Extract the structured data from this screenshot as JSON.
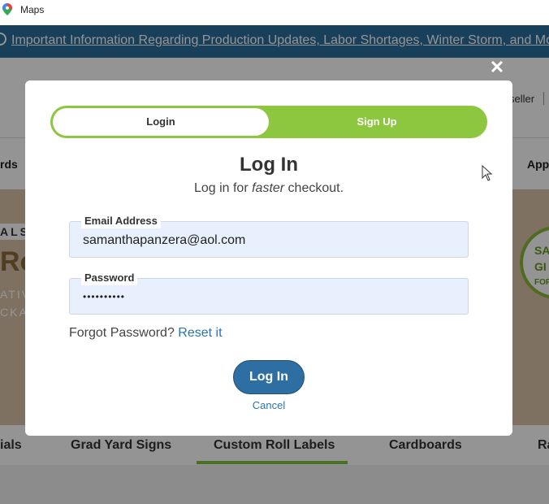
{
  "browser": {
    "title": "Maps"
  },
  "page": {
    "banner_text": "Important Information Regarding Production Updates, Labor Shortages, Winter Storm, and Mo",
    "header_reseller": "seller",
    "nav": {
      "left_cut": "rds",
      "right_cut": "Appa"
    },
    "hero": {
      "tag": "ALS",
      "headline": "Ro",
      "sub_lines": [
        "ATIV",
        "CKAC"
      ],
      "seal_lines": [
        "SA",
        "GI",
        "FOR 15T"
      ]
    },
    "category_tabs": [
      "ials",
      "Grad Yard Signs",
      "Custom Roll Labels",
      "Cardboards",
      "Ra"
    ]
  },
  "modal": {
    "close_symbol": "✕",
    "toggle": {
      "login_label": "Login",
      "signup_label": "Sign Up",
      "active": "login"
    },
    "title": "Log In",
    "subtitle_prefix": "Log in for ",
    "subtitle_emphasis": "faster",
    "subtitle_suffix": " checkout.",
    "email": {
      "label": "Email Address",
      "value": "samanthapanzera@aol.com"
    },
    "password": {
      "label": "Password",
      "masked_value": "••••••••••"
    },
    "forgot_text": "Forgot Password?",
    "reset_link": "Reset it",
    "submit_label": "Log In",
    "cancel_label": "Cancel"
  },
  "colors": {
    "accent_green": "#8dc63f",
    "primary_blue": "#2d6ea3",
    "link_blue": "#2b73b0",
    "banner_blue": "#2b6f9c"
  }
}
